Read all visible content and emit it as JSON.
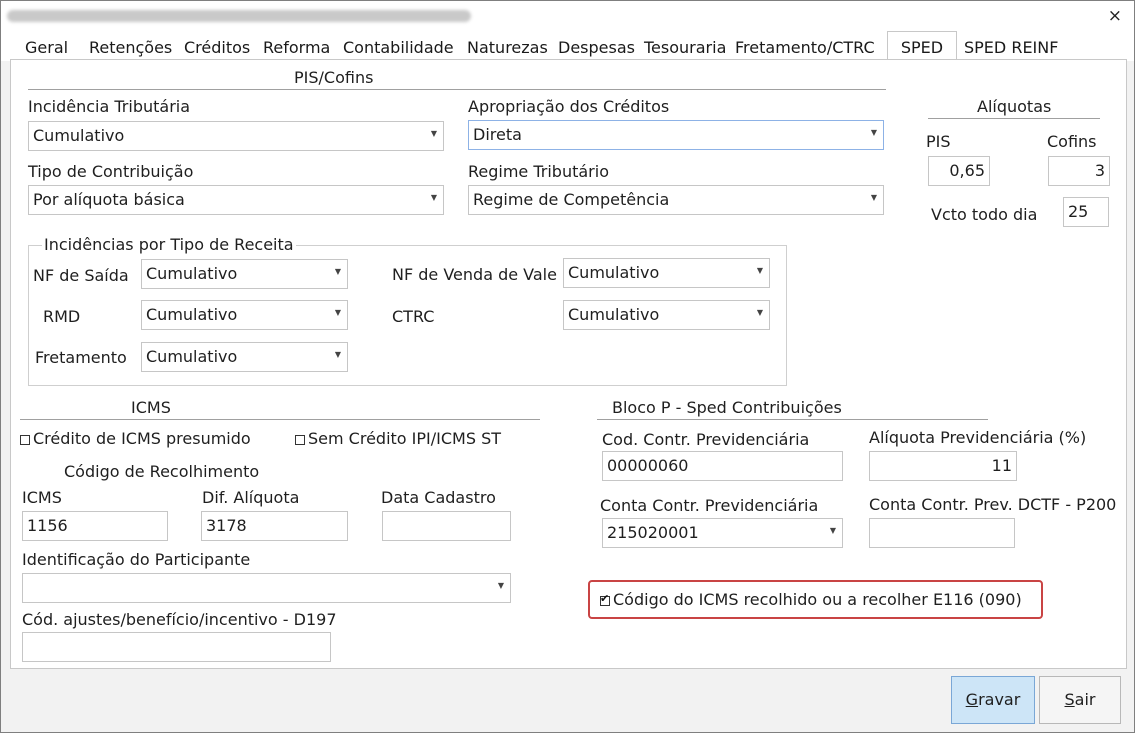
{
  "window": {
    "close_label": "×"
  },
  "tabs": [
    {
      "label": "Geral"
    },
    {
      "label": "Retenções"
    },
    {
      "label": "Créditos"
    },
    {
      "label": "Reforma"
    },
    {
      "label": "Contabilidade"
    },
    {
      "label": "Naturezas"
    },
    {
      "label": "Despesas"
    },
    {
      "label": "Tesouraria"
    },
    {
      "label": "Fretamento/CTRC"
    },
    {
      "label": "SPED"
    },
    {
      "label": "SPED REINF"
    }
  ],
  "pis_cofins": {
    "section_title": "PIS/Cofins",
    "incidencia_label": "Incidência Tributária",
    "incidencia_value": "Cumulativo",
    "apropriacao_label": "Apropriação dos Créditos",
    "apropriacao_value": "Direta",
    "tipo_contrib_label": "Tipo de Contribuição",
    "tipo_contrib_value": "Por alíquota básica",
    "regime_label": "Regime Tributário",
    "regime_value": "Regime de Competência"
  },
  "aliquotas": {
    "section_title": "Alíquotas",
    "pis_label": "PIS",
    "pis_value": "0,65",
    "cofins_label": "Cofins",
    "cofins_value": "3",
    "vcto_label": "Vcto todo dia",
    "vcto_value": "25"
  },
  "incidencias": {
    "group_title": "Incidências por Tipo de Receita",
    "nf_saida_label": "NF de Saída",
    "nf_saida_value": "Cumulativo",
    "rmd_label": "RMD",
    "rmd_value": "Cumulativo",
    "fretamento_label": "Fretamento",
    "fretamento_value": "Cumulativo",
    "nf_vale_label": "NF de Venda de Vale",
    "nf_vale_value": "Cumulativo",
    "ctrc_label": "CTRC",
    "ctrc_value": "Cumulativo"
  },
  "icms": {
    "section_title": "ICMS",
    "credito_presumido_label": "Crédito de ICMS presumido",
    "credito_presumido_checked": false,
    "sem_credito_label": "Sem Crédito IPI/ICMS ST",
    "sem_credito_checked": false,
    "codigo_recolhimento_label": "Código de Recolhimento",
    "icms_label": "ICMS",
    "icms_value": "1156",
    "dif_aliquota_label": "Dif. Alíquota",
    "dif_aliquota_value": "3178",
    "data_cadastro_label": "Data Cadastro",
    "data_cadastro_value": "",
    "identificacao_label": "Identificação do Participante",
    "identificacao_value": "",
    "ajustes_label": "Cód. ajustes/benefício/incentivo - D197",
    "ajustes_value": ""
  },
  "bloco_p": {
    "section_title": "Bloco P - Sped Contribuições",
    "cod_contr_label": "Cod. Contr. Previdenciária",
    "cod_contr_value": "00000060",
    "aliquota_prev_label": "Alíquota Previdenciária (%)",
    "aliquota_prev_value": "11",
    "conta_contr_label": "Conta Contr. Previdenciária",
    "conta_contr_value": "215020001",
    "conta_dctf_label": "Conta Contr. Prev. DCTF - P200",
    "conta_dctf_value": "",
    "e116_label": "Código do ICMS recolhido ou a recolher E116 (090)",
    "e116_checked": true
  },
  "buttons": {
    "gravar_first": "G",
    "gravar_rest": "ravar",
    "sair_first": "S",
    "sair_rest": "air"
  }
}
